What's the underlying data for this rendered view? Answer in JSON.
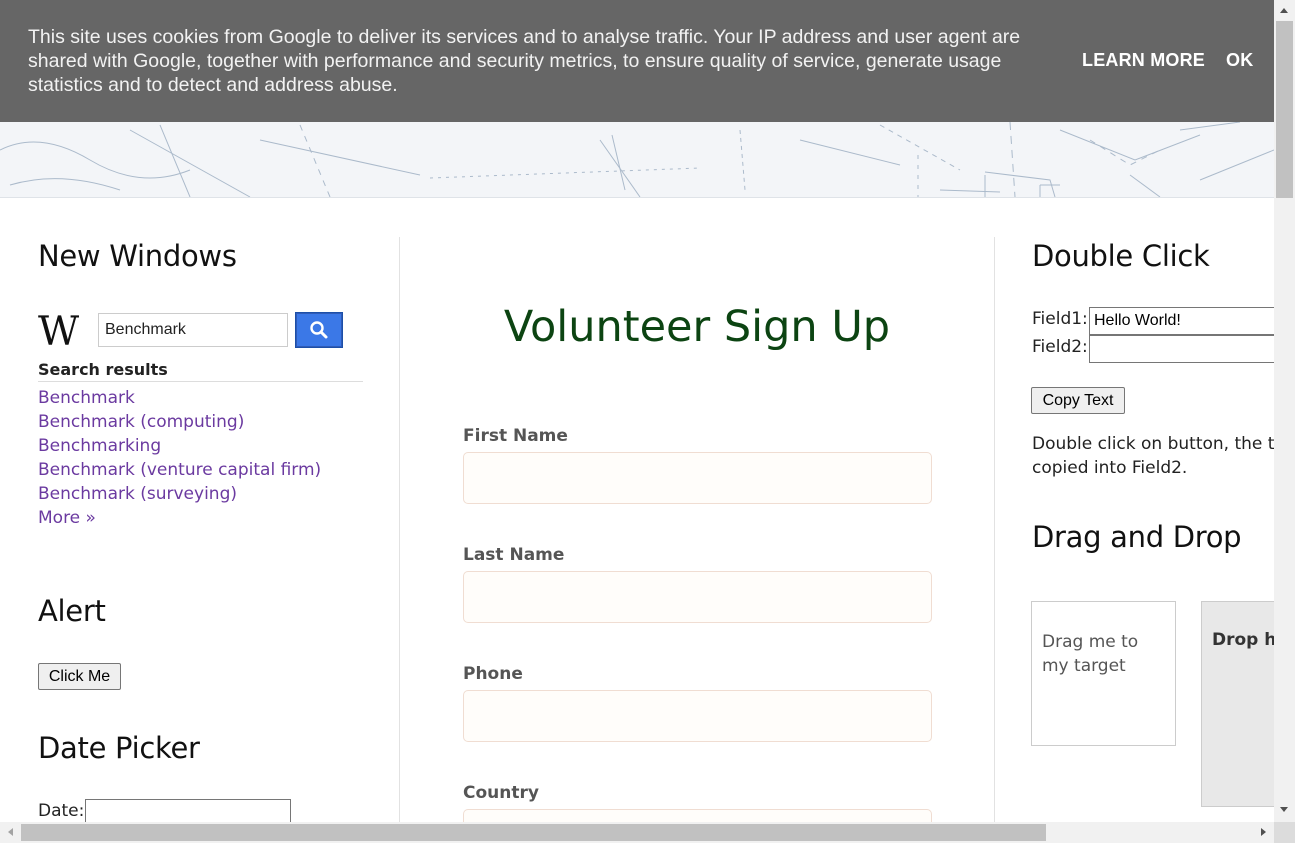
{
  "cookie_bar": {
    "text": "This site uses cookies from Google to deliver its services and to analyse traffic. Your IP address and user agent are shared with Google, together with performance and security metrics, to ensure quality of service, generate usage statistics and to detect and address abuse.",
    "learn_more": "LEARN MORE",
    "ok": "OK"
  },
  "new_windows": {
    "heading": "New Windows",
    "logo": "W",
    "search_value": "Benchmark",
    "search_icon": "search-icon",
    "results_heading": "Search results",
    "results": [
      "Benchmark",
      "Benchmark (computing)",
      "Benchmarking",
      "Benchmark (venture capital firm)",
      "Benchmark (surveying)",
      "More »"
    ]
  },
  "alert": {
    "heading": "Alert",
    "button": "Click Me"
  },
  "date_picker": {
    "heading": "Date Picker",
    "label": "Date:",
    "value": ""
  },
  "form": {
    "title": "Volunteer Sign Up",
    "fields": {
      "first_name": "First Name",
      "last_name": "Last Name",
      "phone": "Phone",
      "country": "Country"
    }
  },
  "double_click": {
    "heading": "Double Click",
    "field1_label": "Field1:",
    "field1_value": "Hello World!",
    "field2_label": "Field2:",
    "field2_value": "",
    "button": "Copy Text",
    "desc_line1": "Double click on button, the tex",
    "desc_line2": "copied into Field2."
  },
  "drag_drop": {
    "heading": "Drag and Drop",
    "draggable": "Drag me to my target",
    "droppable": "Drop he"
  },
  "colors": {
    "cookie_bg": "#666666",
    "link": "#6b3aa0",
    "title_green": "#0c4412",
    "search_button": "#3b78e7"
  }
}
